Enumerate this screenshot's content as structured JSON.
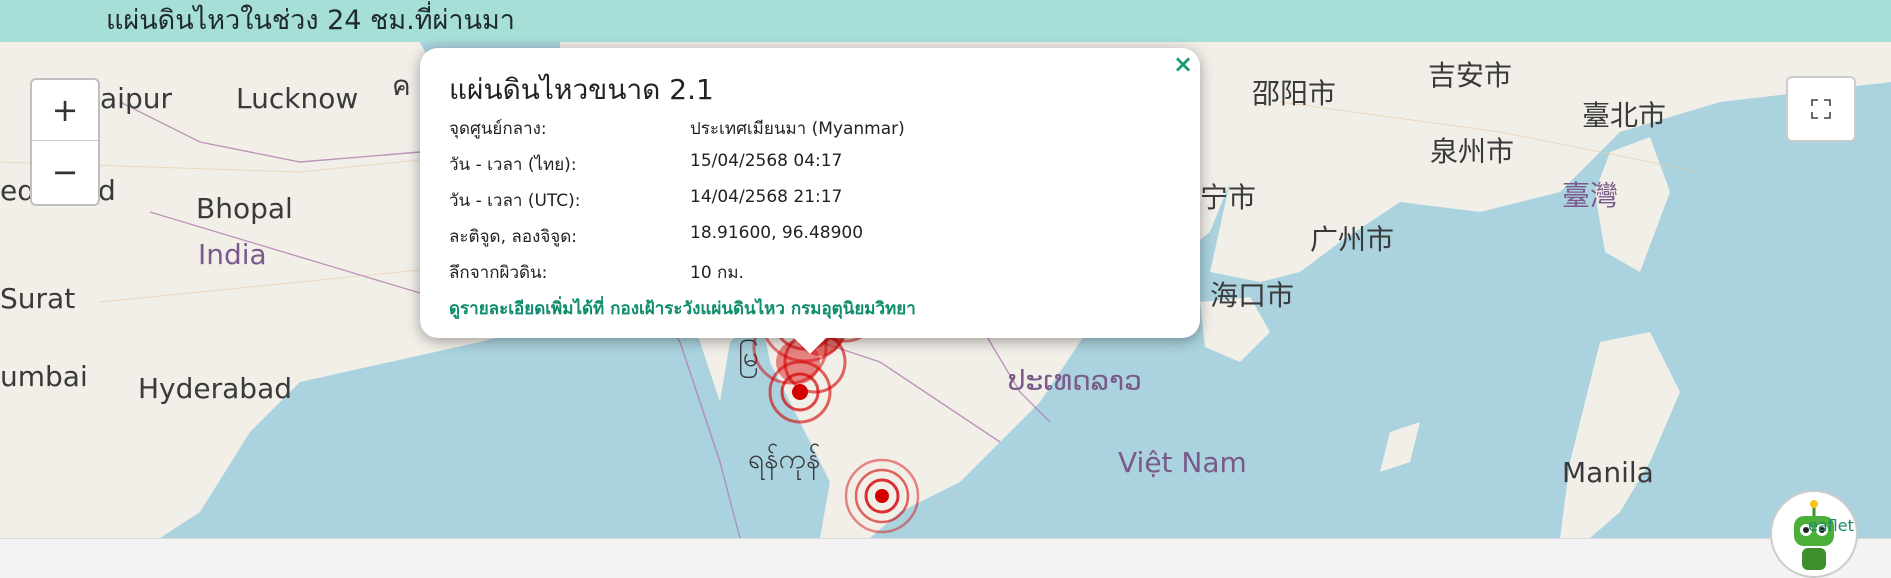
{
  "header": {
    "title": "แผ่นดินไหวในช่วง 24 ชม.ที่ผ่านมา"
  },
  "map": {
    "labels": {
      "jaipur": "aipur",
      "lucknow": "Lucknow",
      "kathmandu_fragment": "ค",
      "bhopal": "Bhopal",
      "india": "India",
      "surat": "Surat",
      "ahmedabad_fragment": "ed",
      "ahmedabad_fragment2": "d",
      "mumbai": "umbai",
      "hyderabad": "Hyderabad",
      "myanmar_fragment": "မြ",
      "yangon": "ရန်ကုန်",
      "laos": "ປະເທດລາວ",
      "vietnam": "Việt Nam",
      "manila": "Manila",
      "shaoyang": "邵阳市",
      "jian": "吉安市",
      "taipei": "臺北市",
      "quanzhou": "泉州市",
      "taiwan": "臺灣",
      "guangzhou": "广州市",
      "haikou": "海口市",
      "nanning_fragment": "宁市"
    }
  },
  "zoom": {
    "in_label": "+",
    "out_label": "−"
  },
  "popup": {
    "close_label": "×",
    "title": "แผ่นดินไหวขนาด 2.1",
    "rows": [
      {
        "label": "จุดศูนย์กลาง:",
        "value": "ประเทศเมียนมา (Myanmar)"
      },
      {
        "label": "วัน - เวลา (ไทย):",
        "value": "15/04/2568 04:17"
      },
      {
        "label": "วัน - เวลา (UTC):",
        "value": "14/04/2568 21:17"
      },
      {
        "label": "ละติจูด, ลองจิจูด:",
        "value": "18.91600, 96.48900"
      },
      {
        "label": "ลึกจากผิวดิน:",
        "value": "10 กม."
      }
    ],
    "link_text": "ดูรายละเอียดเพิ่มได้ที่ กองเฝ้าระวังแผ่นดินไหว กรมอุตุนิยมวิทยา"
  },
  "attribution": {
    "text": "eaflet"
  },
  "colors": {
    "header_bg": "#a6ded8",
    "water": "#aad3df",
    "land": "#f2efe9",
    "quake_red": "#d40000",
    "link_green": "#0e8c6e"
  },
  "icons": {
    "fullscreen": "fullscreen-icon",
    "quake": "earthquake-marker-icon",
    "mascot": "mascot-robot-icon"
  }
}
